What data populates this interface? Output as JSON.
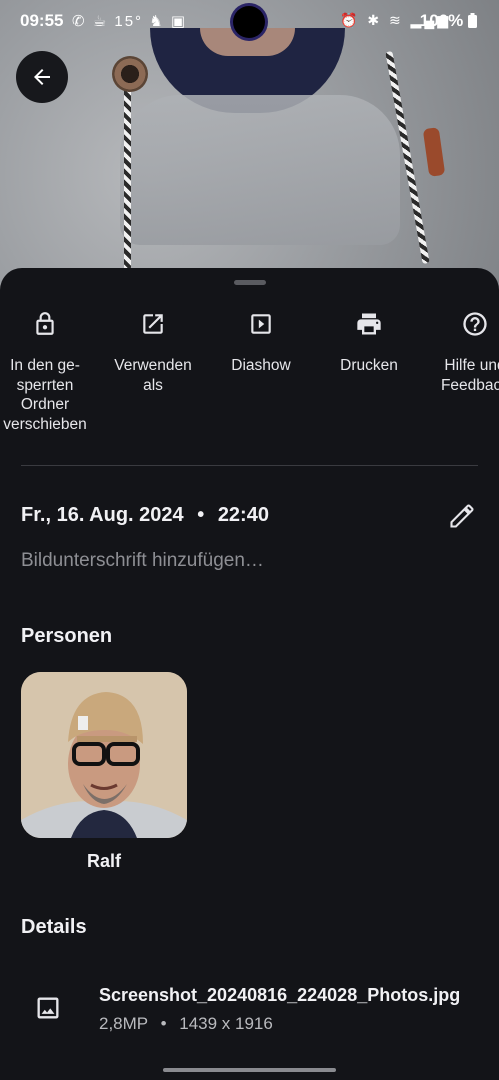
{
  "status_bar": {
    "time": "09:55",
    "left_icons": "✆ ☕ 15° ♞ ▣",
    "right_icons": "⏰ ✱ ≋ ▂▄▆",
    "battery": "100%"
  },
  "actions": [
    {
      "label": "In den ge-\nsperrten\nOrdner\nverschieben",
      "icon": "lock-icon"
    },
    {
      "label": "Verwenden\nals",
      "icon": "open-external-icon"
    },
    {
      "label": "Diashow",
      "icon": "slideshow-icon"
    },
    {
      "label": "Drucken",
      "icon": "print-icon"
    },
    {
      "label": "Hilfe und\nFeedback",
      "icon": "help-icon"
    }
  ],
  "info": {
    "date": "Fr., 16. Aug. 2024",
    "separator": "•",
    "time": "22:40",
    "caption_placeholder": "Bildunterschrift hinzufügen…"
  },
  "people": {
    "title": "Personen",
    "items": [
      {
        "name": "Ralf"
      }
    ]
  },
  "details": {
    "title": "Details",
    "file_name": "Screenshot_20240816_224028_Photos.jpg",
    "megapixels": "2,8MP",
    "meta_separator": "•",
    "dimensions": "1439 x 1916"
  },
  "colors": {
    "background": "#131418",
    "text": "#e6e6ea",
    "secondary_text": "#8e8f94"
  }
}
